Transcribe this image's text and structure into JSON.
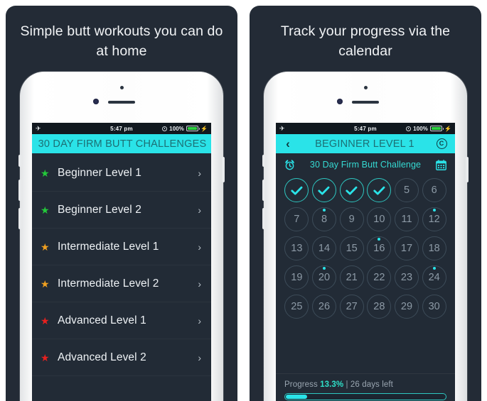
{
  "theme": {
    "panel_bg": "#232b36",
    "screen_bg": "#222b36",
    "accent_cyan": "#2ae3e8",
    "nav_text": "#1c6f74",
    "star_green": "#23c93a",
    "star_orange": "#f0a020",
    "star_red": "#e8201e"
  },
  "panels": [
    {
      "headline": "Simple butt workouts you can do at home",
      "status_bar": {
        "airplane_icon": "airplane-mode-icon",
        "time": "5:47 pm",
        "lock_icon": "rotation-lock-icon",
        "battery_percent": "100%",
        "charging_icon": "charging-bolt-icon"
      },
      "nav": {
        "title": "30 DAY FIRM BUTT CHALLENGES"
      },
      "levels": [
        {
          "label": "Beginner Level 1",
          "star": "★",
          "star_color": "#23c93a",
          "chevron": "›"
        },
        {
          "label": "Beginner Level 2",
          "star": "★",
          "star_color": "#23c93a",
          "chevron": "›"
        },
        {
          "label": "Intermediate Level 1",
          "star": "★",
          "star_color": "#f0a020",
          "chevron": "›"
        },
        {
          "label": "Intermediate Level 2",
          "star": "★",
          "star_color": "#f0a020",
          "chevron": "›"
        },
        {
          "label": "Advanced Level 1",
          "star": "★",
          "star_color": "#e8201e",
          "chevron": "›"
        },
        {
          "label": "Advanced Level 2",
          "star": "★",
          "star_color": "#e8201e",
          "chevron": "›"
        }
      ]
    },
    {
      "headline": "Track your progress via the calendar",
      "status_bar": {
        "airplane_icon": "airplane-mode-icon",
        "time": "5:47 pm",
        "lock_icon": "rotation-lock-icon",
        "battery_percent": "100%",
        "charging_icon": "charging-bolt-icon"
      },
      "nav": {
        "back_label": "‹",
        "title": "BEGINNER LEVEL 1",
        "reset_label": "C"
      },
      "challenge": {
        "alarm_icon": "alarm-clock-icon",
        "title": "30 Day Firm Butt Challenge",
        "calendar_icon": "calendar-icon"
      },
      "calendar": {
        "days": [
          {
            "day": "1",
            "completed": true,
            "dot": false
          },
          {
            "day": "2",
            "completed": true,
            "dot": false
          },
          {
            "day": "3",
            "completed": true,
            "dot": false
          },
          {
            "day": "4",
            "completed": true,
            "dot": false
          },
          {
            "day": "5",
            "completed": false,
            "dot": false
          },
          {
            "day": "6",
            "completed": false,
            "dot": false
          },
          {
            "day": "7",
            "completed": false,
            "dot": false
          },
          {
            "day": "8",
            "completed": false,
            "dot": true
          },
          {
            "day": "9",
            "completed": false,
            "dot": false
          },
          {
            "day": "10",
            "completed": false,
            "dot": false
          },
          {
            "day": "11",
            "completed": false,
            "dot": false
          },
          {
            "day": "12",
            "completed": false,
            "dot": true
          },
          {
            "day": "13",
            "completed": false,
            "dot": false
          },
          {
            "day": "14",
            "completed": false,
            "dot": false
          },
          {
            "day": "15",
            "completed": false,
            "dot": false
          },
          {
            "day": "16",
            "completed": false,
            "dot": true
          },
          {
            "day": "17",
            "completed": false,
            "dot": false
          },
          {
            "day": "18",
            "completed": false,
            "dot": false
          },
          {
            "day": "19",
            "completed": false,
            "dot": false
          },
          {
            "day": "20",
            "completed": false,
            "dot": true
          },
          {
            "day": "21",
            "completed": false,
            "dot": false
          },
          {
            "day": "22",
            "completed": false,
            "dot": false
          },
          {
            "day": "23",
            "completed": false,
            "dot": false
          },
          {
            "day": "24",
            "completed": false,
            "dot": true
          },
          {
            "day": "25",
            "completed": false,
            "dot": false
          },
          {
            "day": "26",
            "completed": false,
            "dot": false
          },
          {
            "day": "27",
            "completed": false,
            "dot": false
          },
          {
            "day": "28",
            "completed": false,
            "dot": false
          },
          {
            "day": "29",
            "completed": false,
            "dot": false
          },
          {
            "day": "30",
            "completed": false,
            "dot": false
          }
        ]
      },
      "progress": {
        "label": "Progress",
        "percent_text": "13.3%",
        "separator": "|",
        "remaining_text": "26 days left",
        "fill_percent": 13.3
      }
    }
  ]
}
